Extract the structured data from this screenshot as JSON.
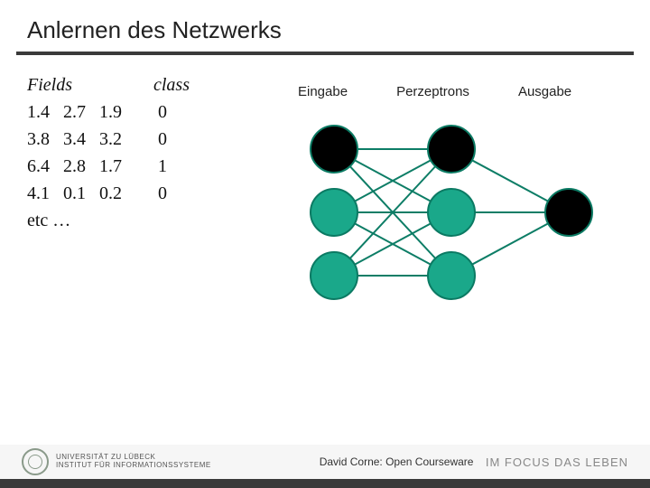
{
  "title": "Anlernen des Netzwerks",
  "table": {
    "fields_header": "Fields",
    "class_header": "class",
    "rows": [
      {
        "f": [
          "1.4",
          "2.7",
          "1.9"
        ],
        "c": "0"
      },
      {
        "f": [
          "3.8",
          "3.4",
          "3.2"
        ],
        "c": "0"
      },
      {
        "f": [
          "6.4",
          "2.8",
          "1.7"
        ],
        "c": "1"
      },
      {
        "f": [
          "4.1",
          "0.1",
          "0.2"
        ],
        "c": "0"
      }
    ],
    "etc": "etc …"
  },
  "net": {
    "labels": {
      "input": "Eingabe",
      "hidden": "Perzeptrons",
      "output": "Ausgabe"
    },
    "node_fill": "#1aa88a",
    "node_stroke": "#0b7a63",
    "highlight_fill": "#000000"
  },
  "footer": {
    "university_line1": "UNIVERSITÄT ZU LÜBECK",
    "university_line2": "INSTITUT FÜR INFORMATIONSSYSTEME",
    "courseware": "David Corne: Open Courseware",
    "focus": "IM FOCUS DAS LEBEN"
  }
}
